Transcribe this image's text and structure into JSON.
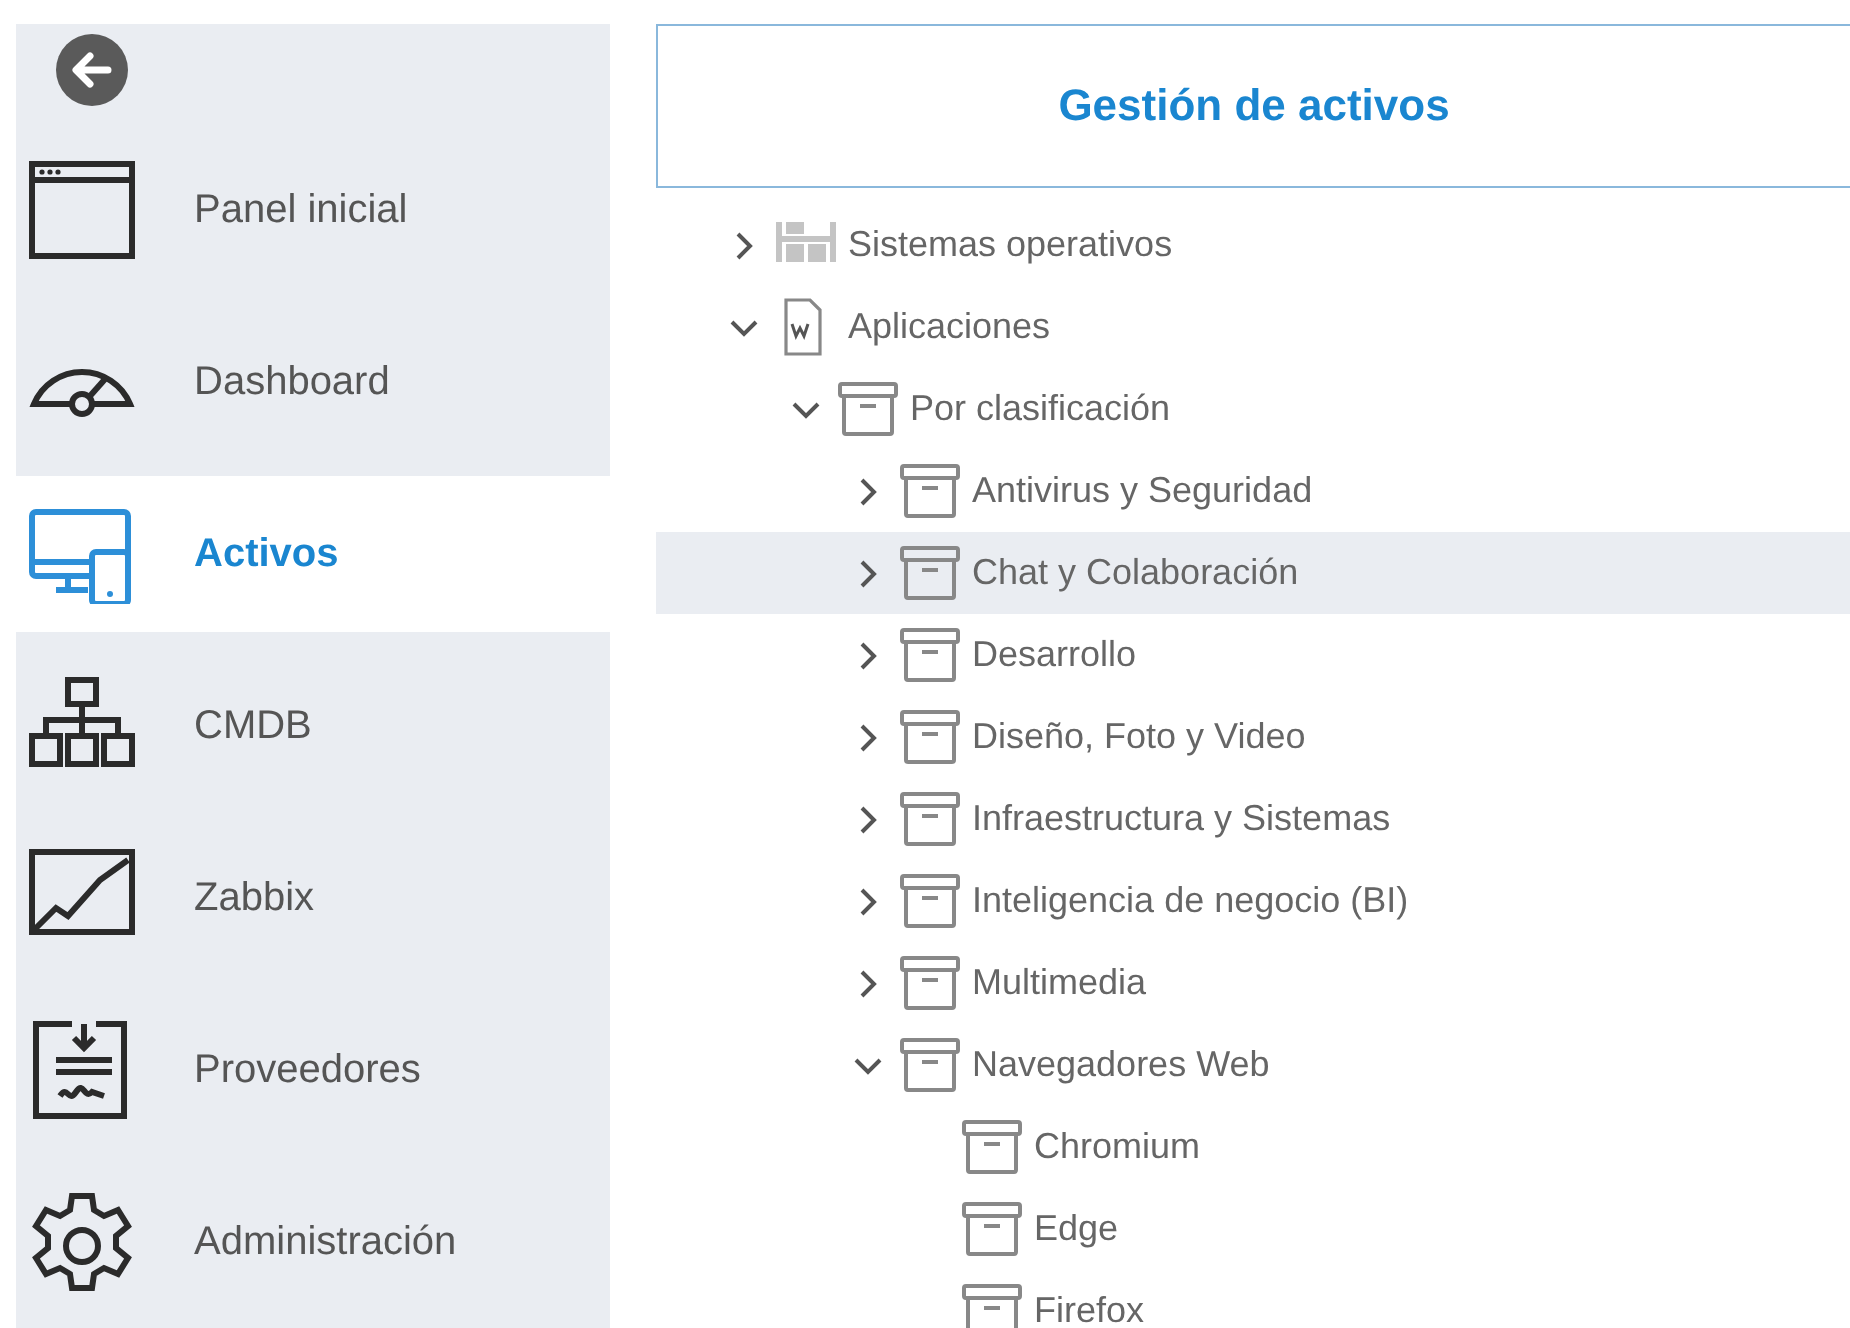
{
  "sidebar": {
    "items": [
      {
        "label": "Panel inicial",
        "kind": "window",
        "selected": false
      },
      {
        "label": "Dashboard",
        "kind": "gauge",
        "selected": false
      },
      {
        "label": "Activos",
        "kind": "devices",
        "selected": true
      },
      {
        "label": "CMDB",
        "kind": "hierarchy",
        "selected": false
      },
      {
        "label": "Zabbix",
        "kind": "chart",
        "selected": false
      },
      {
        "label": "Proveedores",
        "kind": "contract",
        "selected": false
      },
      {
        "label": "Administración",
        "kind": "gear",
        "selected": false
      }
    ]
  },
  "header": {
    "title": "Gestión de activos"
  },
  "tree": [
    {
      "label": "Sistemas operativos",
      "kind": "grid",
      "expanded": false,
      "selected": false
    },
    {
      "label": "Aplicaciones",
      "kind": "document",
      "expanded": true,
      "selected": false,
      "children": [
        {
          "label": "Por clasificación",
          "kind": "box",
          "expanded": true,
          "selected": false,
          "children": [
            {
              "label": "Antivirus y Seguridad",
              "kind": "box",
              "expanded": false,
              "selected": false
            },
            {
              "label": "Chat y Colaboración",
              "kind": "box",
              "expanded": false,
              "selected": true
            },
            {
              "label": "Desarrollo",
              "kind": "box",
              "expanded": false,
              "selected": false
            },
            {
              "label": "Diseño, Foto y Video",
              "kind": "box",
              "expanded": false,
              "selected": false
            },
            {
              "label": "Infraestructura y Sistemas",
              "kind": "box",
              "expanded": false,
              "selected": false
            },
            {
              "label": "Inteligencia de negocio (BI)",
              "kind": "box",
              "expanded": false,
              "selected": false
            },
            {
              "label": "Multimedia",
              "kind": "box",
              "expanded": false,
              "selected": false
            },
            {
              "label": "Navegadores Web",
              "kind": "box",
              "expanded": true,
              "selected": false,
              "children": [
                {
                  "label": "Chromium",
                  "kind": "box",
                  "selected": false
                },
                {
                  "label": "Edge",
                  "kind": "box",
                  "selected": false
                },
                {
                  "label": "Firefox",
                  "kind": "box",
                  "selected": false
                }
              ]
            }
          ]
        }
      ]
    }
  ]
}
